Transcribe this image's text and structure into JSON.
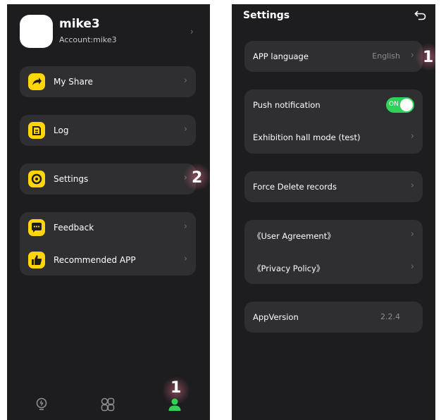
{
  "profile": {
    "username": "mike3",
    "account": "Account:mike3"
  },
  "menu": {
    "my_share": "My Share",
    "log": "Log",
    "settings": "Settings",
    "feedback": "Feedback",
    "recommended": "Recommended APP"
  },
  "markers": {
    "tab_me": "1",
    "settings": "2",
    "language": "1"
  },
  "settings": {
    "title": "Settings",
    "app_language": "APP language",
    "language_value": "English",
    "push_notification": "Push notification",
    "push_state": "ON",
    "exhibition_mode": "Exhibition hall mode (test)",
    "force_delete": "Force Delete records",
    "user_agreement": "《User Agreement》",
    "privacy_policy": "《Privacy Policy》",
    "app_version_label": "AppVersion",
    "app_version": "2.2.4"
  },
  "icons": {
    "tabs": [
      "lightbulb-icon",
      "grid-icon",
      "person-icon"
    ],
    "accent": "#ffd60a",
    "active_tab": "#30d158",
    "toggle_on": "#30d158"
  }
}
